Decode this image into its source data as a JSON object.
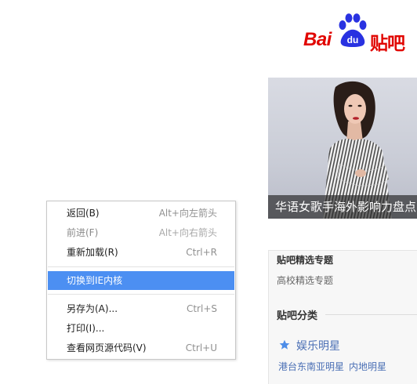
{
  "logo": {
    "part1": "Bai",
    "part2": "du",
    "part3": "贴吧",
    "color": "#e10601",
    "accent": "#2932e1"
  },
  "banner": {
    "caption": "华语女歌手海外影响力盘点"
  },
  "panel": {
    "title": "贴吧精选专题",
    "link": "高校精选专题",
    "section": "贴吧分类",
    "category": "娱乐明星",
    "category_icon": "star-icon",
    "subcategories": [
      "港台东南亚明星",
      "内地明星"
    ]
  },
  "context_menu": {
    "items": [
      {
        "label": "返回(B)",
        "shortcut": "Alt+向左箭头",
        "enabled": true
      },
      {
        "label": "前进(F)",
        "shortcut": "Alt+向右箭头",
        "enabled": false
      },
      {
        "label": "重新加载(R)",
        "shortcut": "Ctrl+R",
        "enabled": true
      },
      {
        "label": "切换到IE内核",
        "shortcut": "",
        "enabled": true,
        "highlighted": true
      },
      {
        "label": "另存为(A)...",
        "shortcut": "Ctrl+S",
        "enabled": true
      },
      {
        "label": "打印(I)...",
        "shortcut": "",
        "enabled": true
      },
      {
        "label": "查看网页源代码(V)",
        "shortcut": "Ctrl+U",
        "enabled": true
      }
    ],
    "highlight_color": "#4c8ff2"
  }
}
